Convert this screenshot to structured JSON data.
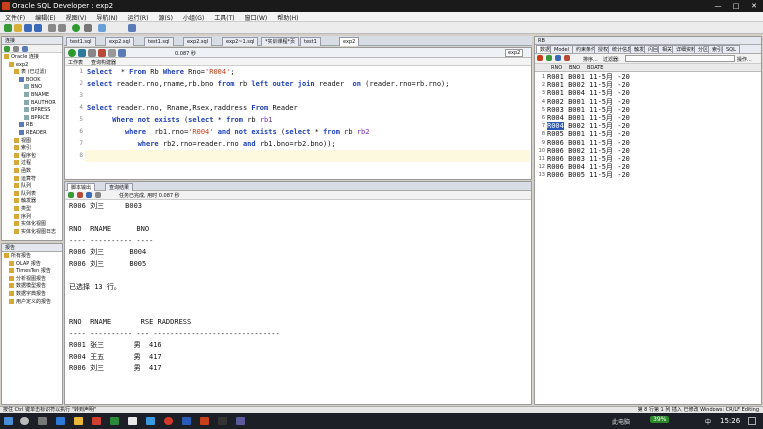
{
  "window": {
    "title": "Oracle SQL Developer : exp2",
    "minimize": "—",
    "maximize": "□",
    "close": "✕"
  },
  "menu": [
    "文件(F)",
    "编辑(E)",
    "视图(V)",
    "导航(N)",
    "运行(R)",
    "源(S)",
    "小组(G)",
    "工具(T)",
    "窗口(W)",
    "帮助(H)"
  ],
  "connections": {
    "header": "连接",
    "tree": [
      {
        "label": "Oracle 连接",
        "indent": 0
      },
      {
        "label": "exp2",
        "indent": 1
      },
      {
        "label": "表 (已过滤)",
        "indent": 2
      },
      {
        "label": "BOOK",
        "indent": 3
      },
      {
        "label": "BNO",
        "indent": 4
      },
      {
        "label": "BNAME",
        "indent": 4
      },
      {
        "label": "BAUTHOR",
        "indent": 4
      },
      {
        "label": "BPRESS",
        "indent": 4
      },
      {
        "label": "BPRICE",
        "indent": 4
      },
      {
        "label": "RB",
        "indent": 3
      },
      {
        "label": "READER",
        "indent": 3
      },
      {
        "label": "视图",
        "indent": 2
      },
      {
        "label": "索引",
        "indent": 2
      },
      {
        "label": "程序包",
        "indent": 2
      },
      {
        "label": "过程",
        "indent": 2
      },
      {
        "label": "函数",
        "indent": 2
      },
      {
        "label": "运算符",
        "indent": 2
      },
      {
        "label": "队列",
        "indent": 2
      },
      {
        "label": "队列表",
        "indent": 2
      },
      {
        "label": "触发器",
        "indent": 2
      },
      {
        "label": "类型",
        "indent": 2
      },
      {
        "label": "序列",
        "indent": 2
      },
      {
        "label": "实体化视图",
        "indent": 2
      },
      {
        "label": "实体化视图日志",
        "indent": 2
      }
    ]
  },
  "reports": {
    "header": "报告",
    "tree": [
      {
        "label": "所有报告",
        "indent": 0
      },
      {
        "label": "OLAP 报告",
        "indent": 1
      },
      {
        "label": "TimesTen 报告",
        "indent": 1
      },
      {
        "label": "分析视图报告",
        "indent": 1
      },
      {
        "label": "数据模型报告",
        "indent": 1
      },
      {
        "label": "数据字典报告",
        "indent": 1
      },
      {
        "label": "用户定义的报告",
        "indent": 1
      }
    ]
  },
  "editor": {
    "tabs": [
      "test1.sql",
      "exp2.sql",
      "test1.sql",
      "exp2.sql",
      "exp2~1.sql",
      "*实训课程*页",
      "test1",
      "exp2"
    ],
    "subtabs": [
      "工作表",
      "查询构建器"
    ],
    "timing": "0.087 秒",
    "connection": "exp2",
    "lines": [
      {
        "n": "1",
        "segs": [
          [
            "kw",
            "Select"
          ],
          [
            "",
            "  * "
          ],
          [
            "kw",
            "From"
          ],
          [
            "",
            " Rb "
          ],
          [
            "kw",
            "Where"
          ],
          [
            "",
            " Rno="
          ],
          [
            "str",
            "'R004'"
          ],
          [
            "",
            ";"
          ]
        ]
      },
      {
        "n": "2",
        "segs": [
          [
            "kw",
            "select"
          ],
          [
            "",
            " reader.rno,rname,rb.bno "
          ],
          [
            "kw",
            "from"
          ],
          [
            "",
            " rb "
          ],
          [
            "kw",
            "left outer join"
          ],
          [
            "",
            " reader  "
          ],
          [
            "kw",
            "on"
          ],
          [
            "",
            " (reader.rno=rb.rno);"
          ]
        ]
      },
      {
        "n": "3",
        "segs": []
      },
      {
        "n": "4",
        "segs": [
          [
            "kw",
            "Select"
          ],
          [
            "",
            " reader.rno, Rname,Rsex,raddress "
          ],
          [
            "kw",
            "From"
          ],
          [
            "",
            " Reader"
          ]
        ]
      },
      {
        "n": "5",
        "segs": [
          [
            "",
            "      "
          ],
          [
            "kw",
            "Where not exists"
          ],
          [
            "",
            " ("
          ],
          [
            "kw",
            "select"
          ],
          [
            "",
            " * "
          ],
          [
            "kw",
            "from"
          ],
          [
            "",
            " rb "
          ],
          [
            "fn",
            "rb1"
          ]
        ]
      },
      {
        "n": "6",
        "segs": [
          [
            "",
            "         "
          ],
          [
            "kw",
            "where"
          ],
          [
            "",
            "  rb1.rno="
          ],
          [
            "str",
            "'R004'"
          ],
          [
            "",
            " "
          ],
          [
            "kw",
            "and not exists"
          ],
          [
            "",
            " ("
          ],
          [
            "kw",
            "select"
          ],
          [
            "",
            " * "
          ],
          [
            "kw",
            "from"
          ],
          [
            "",
            " rb "
          ],
          [
            "fn",
            "rb2"
          ]
        ]
      },
      {
        "n": "7",
        "segs": [
          [
            "",
            "            "
          ],
          [
            "kw",
            "where"
          ],
          [
            "",
            " rb2.rno=reader.rno "
          ],
          [
            "kw",
            "and"
          ],
          [
            "",
            " rb1.bno=rb2.bno));"
          ]
        ]
      },
      {
        "n": "8",
        "segs": []
      }
    ]
  },
  "output": {
    "tabs": [
      "脚本输出",
      "查询结果"
    ],
    "status": "任务已完成, 用时 0.087 秒",
    "lines": [
      "R006 刘三     B003",
      "",
      "RNO  RNAME      BNO",
      "---- ---------- ----",
      "R006 刘三      B004",
      "R006 刘三      B005",
      "",
      "已选择 13 行。",
      "",
      "",
      "RNO  RNAME       RSE RADDRESS",
      "---- ---------- --- ------------------------------",
      "R001 张三       男  416",
      "R004 王五       男  417",
      "R006 刘三       男  417"
    ]
  },
  "results": {
    "tabs": [
      "数据",
      "Model",
      "约束条件",
      "授权",
      "统计信息",
      "触发器",
      "闪回",
      "相关性",
      "详细资料",
      "分区",
      "索引",
      "SQL"
    ],
    "filter_label": "排序...",
    "filter_text": "过滤器:",
    "action": "操作...",
    "columns": [
      "RNO",
      "BNO",
      "BDATE"
    ],
    "rows": [
      [
        "1",
        "R001",
        "B001",
        "11-5月 -20"
      ],
      [
        "2",
        "R001",
        "B002",
        "11-5月 -20"
      ],
      [
        "3",
        "R001",
        "B004",
        "11-5月 -20"
      ],
      [
        "4",
        "R002",
        "B001",
        "11-5月 -20"
      ],
      [
        "5",
        "R003",
        "B001",
        "11-5月 -20"
      ],
      [
        "6",
        "R004",
        "B001",
        "11-5月 -20"
      ],
      [
        "7",
        "R004",
        "B002",
        "11-5月 -20"
      ],
      [
        "8",
        "R005",
        "B001",
        "11-5月 -20"
      ],
      [
        "9",
        "R006",
        "B001",
        "11-5月 -20"
      ],
      [
        "10",
        "R006",
        "B002",
        "11-5月 -20"
      ],
      [
        "11",
        "R006",
        "B003",
        "11-5月 -20"
      ],
      [
        "12",
        "R006",
        "B004",
        "11-5月 -20"
      ],
      [
        "13",
        "R006",
        "B005",
        "11-5月 -20"
      ]
    ],
    "selected_row": 6
  },
  "statusbar": {
    "text": "按住 Ctrl 键单击标识符以执行 \"转到声明\"",
    "right": "第 8 行第 1 列  插入  已修改  Windows: CR/LF  Editing"
  },
  "taskbar": {
    "time": "15:26",
    "battery": "39%",
    "lang": "中",
    "tray": "此电脑"
  }
}
